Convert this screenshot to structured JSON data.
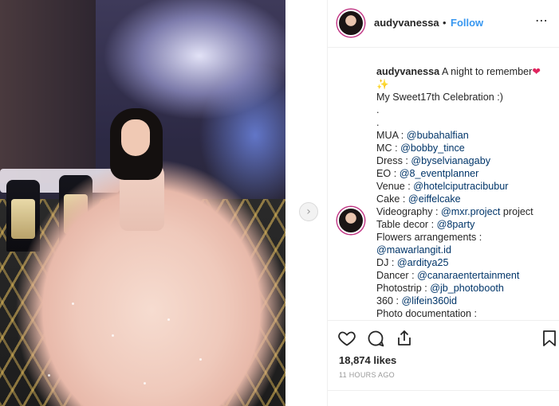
{
  "post": {
    "username": "audyvanessa",
    "separator": "•",
    "follow_label": "Follow",
    "more_icon": "⋯"
  },
  "caption": {
    "username": "audyvanessa",
    "title": "A night to remember",
    "lines": [
      {
        "label": "My Sweet17th Celebration :)",
        "mention": ""
      },
      {
        "label": ".",
        "mention": ""
      },
      {
        "label": ".",
        "mention": ""
      },
      {
        "label": "MUA : ",
        "mention": "@bubahalfian"
      },
      {
        "label": "MC : ",
        "mention": "@bobby_tince"
      },
      {
        "label": "Dress : ",
        "mention": "@byselvianagaby"
      },
      {
        "label": "EO : ",
        "mention": "@8_eventplanner"
      },
      {
        "label": "Venue : ",
        "mention": "@hotelciputracibubur"
      },
      {
        "label": "Cake : ",
        "mention": "@eiffelcake"
      },
      {
        "label": "Videography : ",
        "mention": "@mxr.project",
        "suffix": " project"
      },
      {
        "label": "Table decor : ",
        "mention": "@8party"
      },
      {
        "label": "Flowers arrangements :",
        "mention": ""
      },
      {
        "label": "",
        "mention": "@mawarlangit.id"
      },
      {
        "label": "DJ : ",
        "mention": "@arditya25"
      },
      {
        "label": "Dancer : ",
        "mention": "@canaraentertainment"
      },
      {
        "label": "Photostrip : ",
        "mention": "@jb_photobooth"
      },
      {
        "label": "360 : ",
        "mention": "@lifein360id"
      },
      {
        "label": "Photo documentation :",
        "mention": ""
      }
    ]
  },
  "stats": {
    "likes": "18,874 likes",
    "time": "11 HOURS AGO"
  },
  "icons": {
    "heart": "heart-icon",
    "comment": "comment-icon",
    "share": "share-icon",
    "bookmark": "bookmark-icon",
    "next": "chevron-right-icon"
  },
  "colors": {
    "link": "#003569",
    "follow": "#3897f0",
    "heart": "#e0245e"
  },
  "carousel_next": "›"
}
